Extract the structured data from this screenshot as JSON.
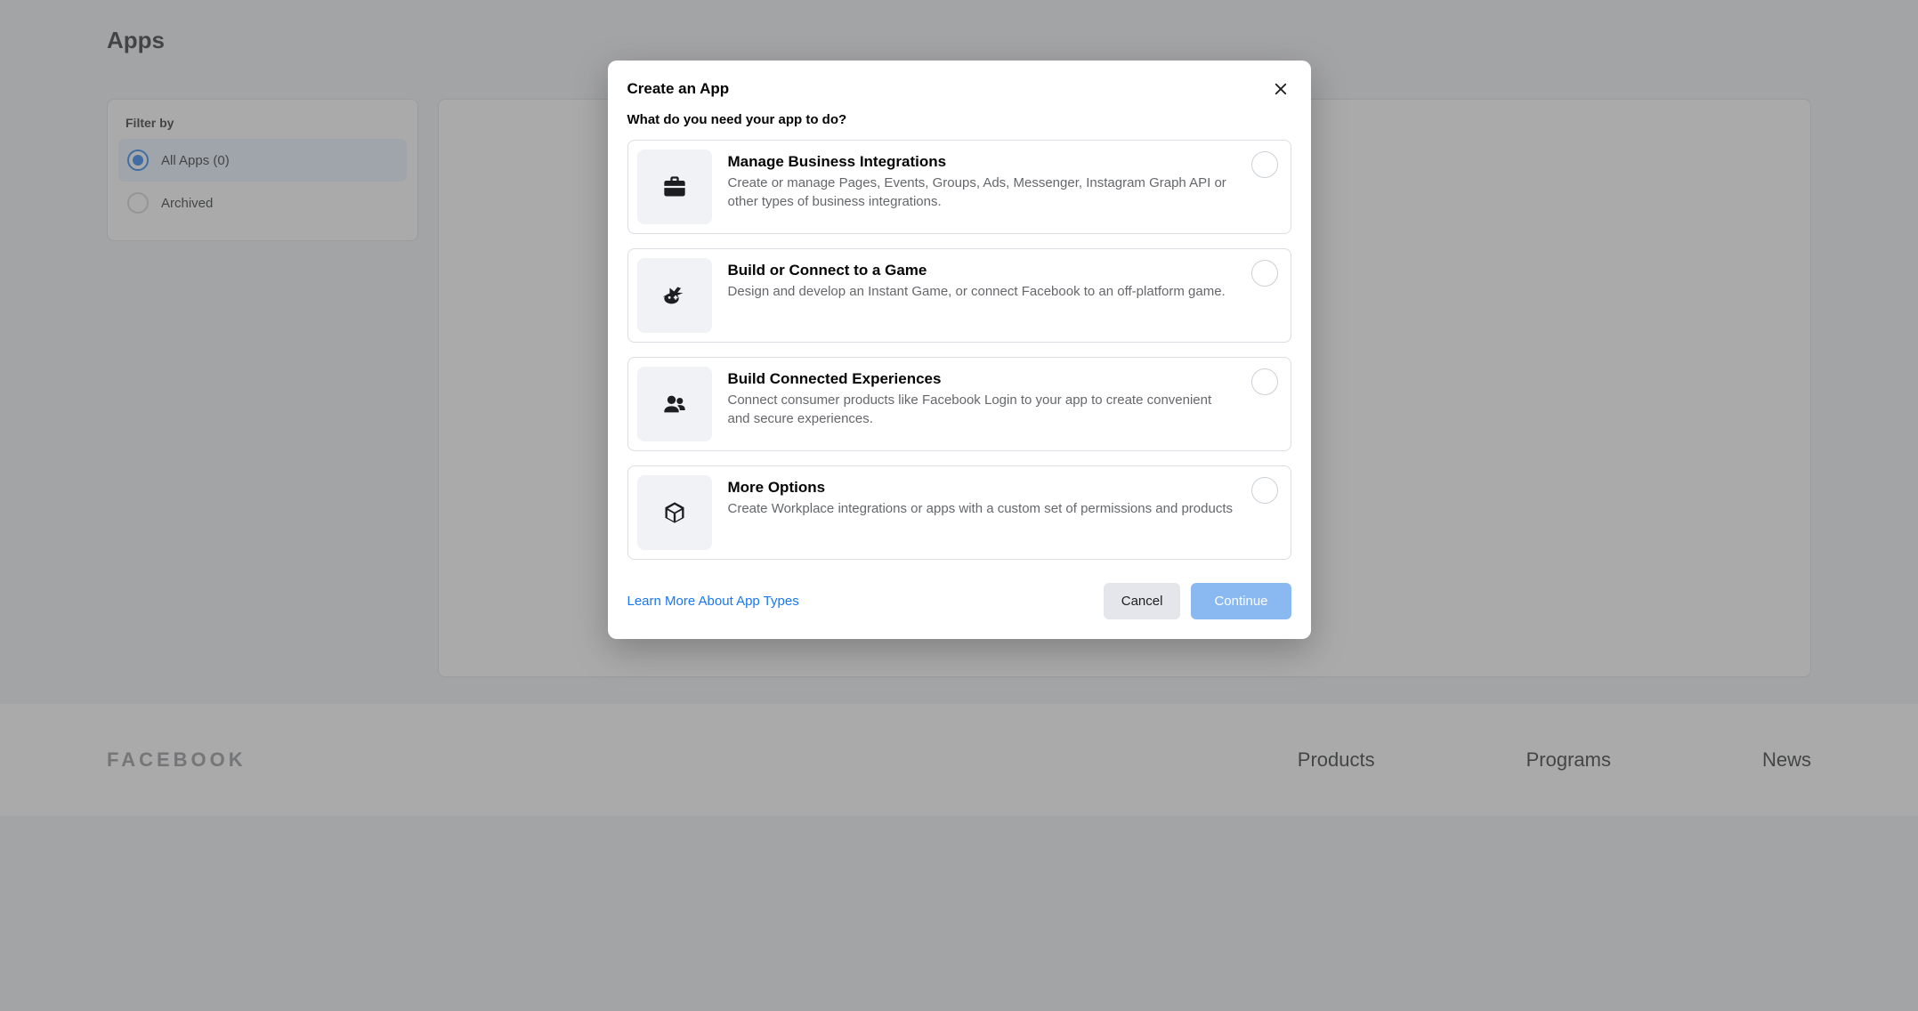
{
  "page": {
    "title": "Apps"
  },
  "sidebar": {
    "filter_label": "Filter by",
    "items": [
      {
        "label": "All Apps (0)",
        "selected": true
      },
      {
        "label": "Archived",
        "selected": false
      }
    ]
  },
  "footer": {
    "brand": "FACEBOOK",
    "columns": [
      {
        "heading": "Products"
      },
      {
        "heading": "Programs"
      },
      {
        "heading": "News"
      }
    ]
  },
  "modal": {
    "title": "Create an App",
    "subtitle": "What do you need your app to do?",
    "options": [
      {
        "title": "Manage Business Integrations",
        "description": "Create or manage Pages, Events, Groups, Ads, Messenger, Instagram Graph API or other types of business integrations.",
        "icon": "briefcase-icon"
      },
      {
        "title": "Build or Connect to a Game",
        "description": "Design and develop an Instant Game, or connect Facebook to an off-platform game.",
        "icon": "game-icon"
      },
      {
        "title": "Build Connected Experiences",
        "description": "Connect consumer products like Facebook Login to your app to create convenient and secure experiences.",
        "icon": "people-icon"
      },
      {
        "title": "More Options",
        "description": "Create Workplace integrations or apps with a custom set of permissions and products",
        "icon": "cube-icon"
      }
    ],
    "learn_more": "Learn More About App Types",
    "cancel": "Cancel",
    "continue": "Continue"
  }
}
